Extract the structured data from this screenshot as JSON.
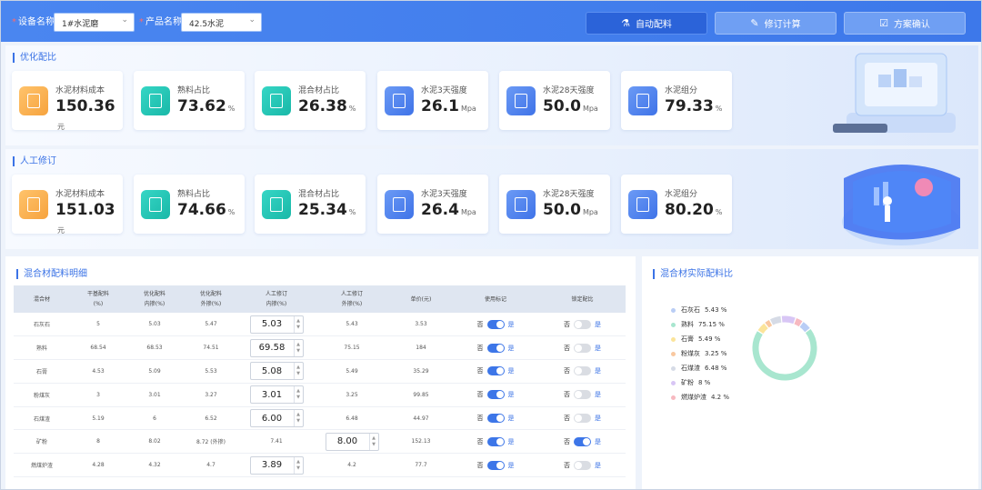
{
  "filters": {
    "device_label": "设备名称",
    "device_value": "1#水泥磨",
    "product_label": "产品名称",
    "product_value": "42.5水泥"
  },
  "buttons": {
    "auto": "自动配料",
    "revise": "修订计算",
    "confirm": "方案确认"
  },
  "optimized": {
    "title": "优化配比",
    "kpis": [
      {
        "label": "水泥材料成本",
        "value": "150.36",
        "unit": "元",
        "icon": "document-icon",
        "color": "orange"
      },
      {
        "label": "熟料占比",
        "value": "73.62",
        "unit": "%",
        "icon": "chart-up-icon",
        "color": "teal"
      },
      {
        "label": "混合材占比",
        "value": "26.38",
        "unit": "%",
        "icon": "mix-icon",
        "color": "teal"
      },
      {
        "label": "水泥3天强度",
        "value": "26.1",
        "unit": "Mpa",
        "icon": "report-icon",
        "color": "blue"
      },
      {
        "label": "水泥28天强度",
        "value": "50.0",
        "unit": "Mpa",
        "icon": "report-icon",
        "color": "blue"
      },
      {
        "label": "水泥组分",
        "value": "79.33",
        "unit": "%",
        "icon": "sprout-icon",
        "color": "blue"
      }
    ]
  },
  "manual": {
    "title": "人工修订",
    "kpis": [
      {
        "label": "水泥材料成本",
        "value": "151.03",
        "unit": "元",
        "icon": "document-icon",
        "color": "orange"
      },
      {
        "label": "熟料占比",
        "value": "74.66",
        "unit": "%",
        "icon": "chart-up-icon",
        "color": "teal"
      },
      {
        "label": "混合材占比",
        "value": "25.34",
        "unit": "%",
        "icon": "mix-icon",
        "color": "teal"
      },
      {
        "label": "水泥3天强度",
        "value": "26.4",
        "unit": "Mpa",
        "icon": "report-icon",
        "color": "blue"
      },
      {
        "label": "水泥28天强度",
        "value": "50.0",
        "unit": "Mpa",
        "icon": "report-icon",
        "color": "blue"
      },
      {
        "label": "水泥组分",
        "value": "80.20",
        "unit": "%",
        "icon": "sprout-icon",
        "color": "blue"
      }
    ]
  },
  "table": {
    "title": "混合材配料明细",
    "headers": [
      {
        "l1": "混合材",
        "l2": ""
      },
      {
        "l1": "干基配料",
        "l2": "(%)"
      },
      {
        "l1": "优化配料",
        "l2": "内掺(%)"
      },
      {
        "l1": "优化配料",
        "l2": "外掺(%)"
      },
      {
        "l1": "人工修订",
        "l2": "内掺(%)"
      },
      {
        "l1": "人工修订",
        "l2": "外掺(%)"
      },
      {
        "l1": "单价(元)",
        "l2": ""
      },
      {
        "l1": "使用标记",
        "l2": ""
      },
      {
        "l1": "锁定配比",
        "l2": ""
      }
    ],
    "rows": [
      {
        "name": "石灰石",
        "dry": "5",
        "opt_in": "5.03",
        "opt_out": "5.47",
        "man_in": "5.03",
        "man_out": "5.43",
        "price": "3.53",
        "use": true,
        "lock": false,
        "edit": "in"
      },
      {
        "name": "熟料",
        "dry": "68.54",
        "opt_in": "68.53",
        "opt_out": "74.51",
        "man_in": "69.58",
        "man_out": "75.15",
        "price": "184",
        "use": true,
        "lock": false,
        "edit": "in"
      },
      {
        "name": "石膏",
        "dry": "4.53",
        "opt_in": "5.09",
        "opt_out": "5.53",
        "man_in": "5.08",
        "man_out": "5.49",
        "price": "35.29",
        "use": true,
        "lock": false,
        "edit": "in"
      },
      {
        "name": "粉煤灰",
        "dry": "3",
        "opt_in": "3.01",
        "opt_out": "3.27",
        "man_in": "3.01",
        "man_out": "3.25",
        "price": "99.85",
        "use": true,
        "lock": false,
        "edit": "in"
      },
      {
        "name": "石煤渣",
        "dry": "5.19",
        "opt_in": "6",
        "opt_out": "6.52",
        "man_in": "6.00",
        "man_out": "6.48",
        "price": "44.97",
        "use": true,
        "lock": false,
        "edit": "in"
      },
      {
        "name": "矿粉",
        "dry": "8",
        "opt_in": "8.02",
        "opt_out": "8.72 (外掺)",
        "man_in": "7.41",
        "man_out": "8.00",
        "price": "152.13",
        "use": true,
        "lock": true,
        "edit": "out"
      },
      {
        "name": "燃煤炉渣",
        "dry": "4.28",
        "opt_in": "4.32",
        "opt_out": "4.7",
        "man_in": "3.89",
        "man_out": "4.2",
        "price": "77.7",
        "use": true,
        "lock": false,
        "edit": "in"
      }
    ],
    "no": "否",
    "yes": "是"
  },
  "ratio": {
    "title": "混合材实际配料比",
    "items": [
      {
        "name": "石灰石",
        "value": "5.43 %",
        "pct": 5.43,
        "color": "#b9cdf5"
      },
      {
        "name": "熟料",
        "value": "75.15 %",
        "pct": 75.15,
        "color": "#a8e6cf"
      },
      {
        "name": "石膏",
        "value": "5.49 %",
        "pct": 5.49,
        "color": "#fbe49a"
      },
      {
        "name": "粉煤灰",
        "value": "3.25 %",
        "pct": 3.25,
        "color": "#f9c8a0"
      },
      {
        "name": "石煤渣",
        "value": "6.48 %",
        "pct": 6.48,
        "color": "#d6dbe6"
      },
      {
        "name": "矿粉",
        "value": "8 %",
        "pct": 8,
        "color": "#d8c6f5"
      },
      {
        "name": "燃煤炉渣",
        "value": "4.2 %",
        "pct": 4.2,
        "color": "#f7b9c0"
      }
    ]
  }
}
